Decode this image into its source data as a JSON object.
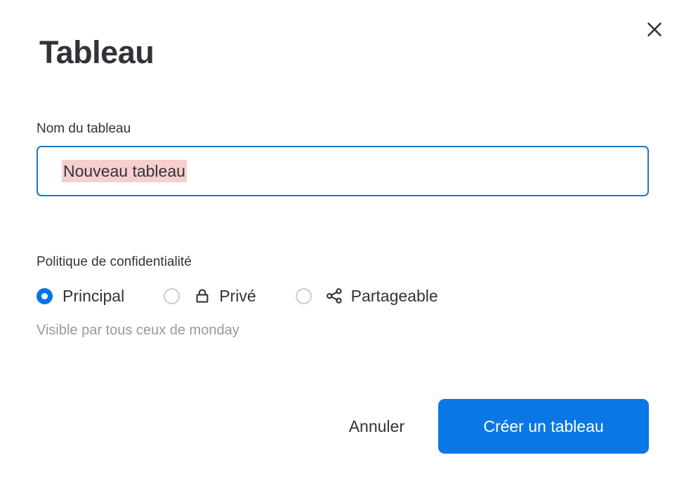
{
  "dialog": {
    "title": "Tableau",
    "close_icon": "close-icon"
  },
  "name_field": {
    "label": "Nom du tableau",
    "value": "Nouveau tableau",
    "placeholder": "Nom du tableau",
    "selection_highlight_color": "#f7cfcf",
    "focus_border_color": "#1f76c2"
  },
  "privacy": {
    "label": "Politique de confidentialité",
    "hint": "Visible par tous ceux de monday",
    "selected": "Principal",
    "options": [
      {
        "label": "Principal",
        "selected": true,
        "icon": ""
      },
      {
        "label": "Privé",
        "selected": false,
        "icon": "lock-icon"
      },
      {
        "label": "Partageable",
        "selected": false,
        "icon": "share-nodes-icon"
      }
    ]
  },
  "footer": {
    "cancel_label": "Annuler",
    "create_label": "Créer un tableau",
    "primary_color": "#0b77e5"
  }
}
